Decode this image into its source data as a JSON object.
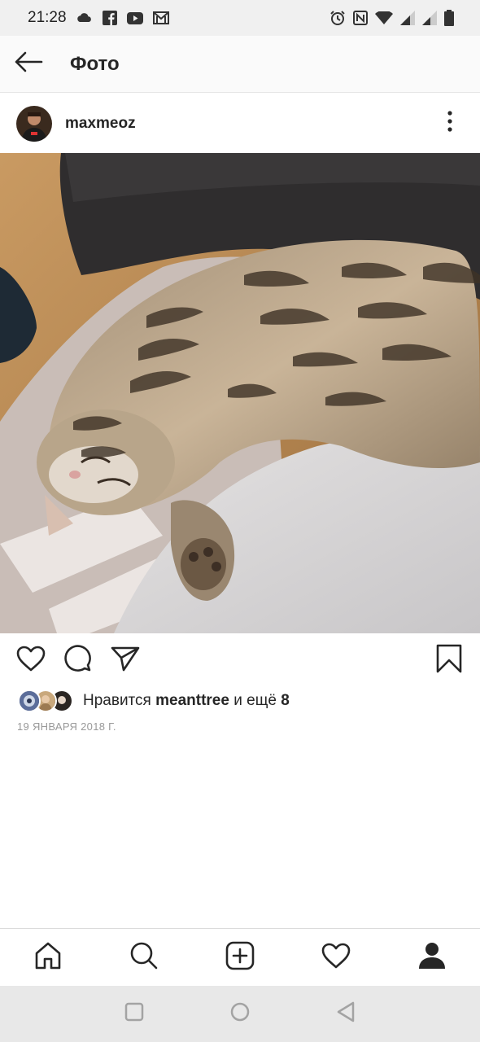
{
  "status_bar": {
    "time": "21:28",
    "left_icons": [
      "cloud-icon",
      "facebook-icon",
      "youtube-icon",
      "gmail-icon"
    ],
    "right_icons": [
      "alarm-icon",
      "nfc-icon",
      "wifi-icon",
      "signal-icon",
      "signal-icon",
      "battery-icon"
    ]
  },
  "header": {
    "title": "Фото",
    "back_icon": "arrow-left-icon"
  },
  "post": {
    "username": "maxmeoz",
    "more_icon": "more-vertical-icon",
    "photo_subject": "sleeping tabby cat"
  },
  "actions": {
    "icons": [
      "heart-icon",
      "comment-icon",
      "send-icon",
      "bookmark-icon"
    ]
  },
  "likes": {
    "prefix": "Нравится",
    "user": "meanttree",
    "middle": "и ещё",
    "count": "8"
  },
  "date": "19 ЯНВАРЯ 2018 Г.",
  "bottom_nav": {
    "items": [
      "home-icon",
      "search-icon",
      "add-icon",
      "activity-heart-icon",
      "profile-icon"
    ]
  },
  "android_nav": {
    "items": [
      "recents-icon",
      "home-circle-icon",
      "back-triangle-icon"
    ]
  },
  "colors": {
    "text": "#262626",
    "secondary": "#999999",
    "border": "#dbdbdb",
    "status_bg": "#f0f0f0",
    "nav_bg": "#e8e8e8"
  }
}
